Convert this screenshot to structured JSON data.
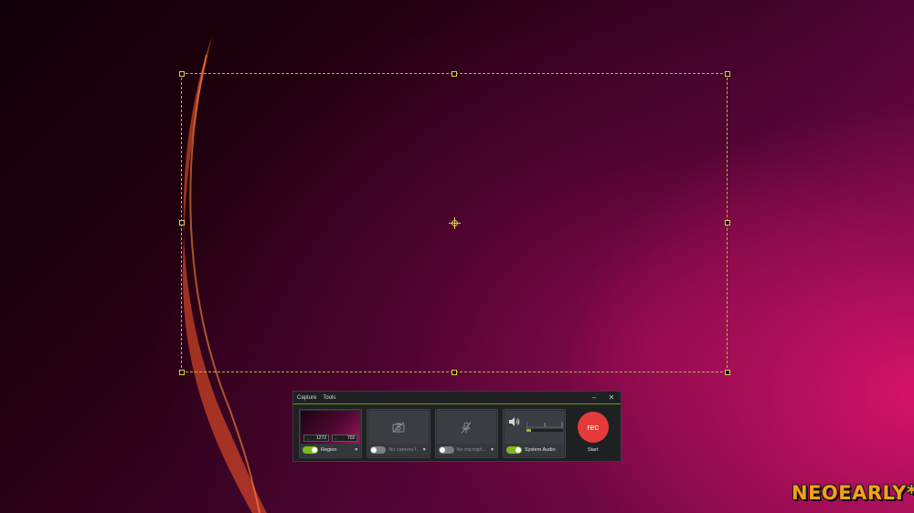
{
  "colors": {
    "accent_green": "#8ec31e",
    "rec_red": "#e53b3b",
    "selection_outline": "#b8b43a",
    "watermark": "#f2a21a"
  },
  "recorder": {
    "menu": [
      "Capture",
      "Tools"
    ],
    "window_controls": {
      "minimize": "–",
      "close": "✕"
    },
    "region": {
      "width_icon": "↔",
      "width": "1272",
      "height_icon": "↕",
      "height": "702",
      "enabled": true,
      "label": "Region"
    },
    "camera": {
      "icon": "camera-off-icon",
      "enabled": false,
      "label": "No camera f..."
    },
    "microphone": {
      "icon": "microphone-off-icon",
      "enabled": false,
      "label": "No microph..."
    },
    "system_audio": {
      "icon": "speaker-icon",
      "enabled": true,
      "label": "System Audio"
    },
    "record": {
      "button_label": "rec",
      "caption": "Start"
    }
  },
  "watermark": {
    "text": "NEOEARLY*"
  }
}
